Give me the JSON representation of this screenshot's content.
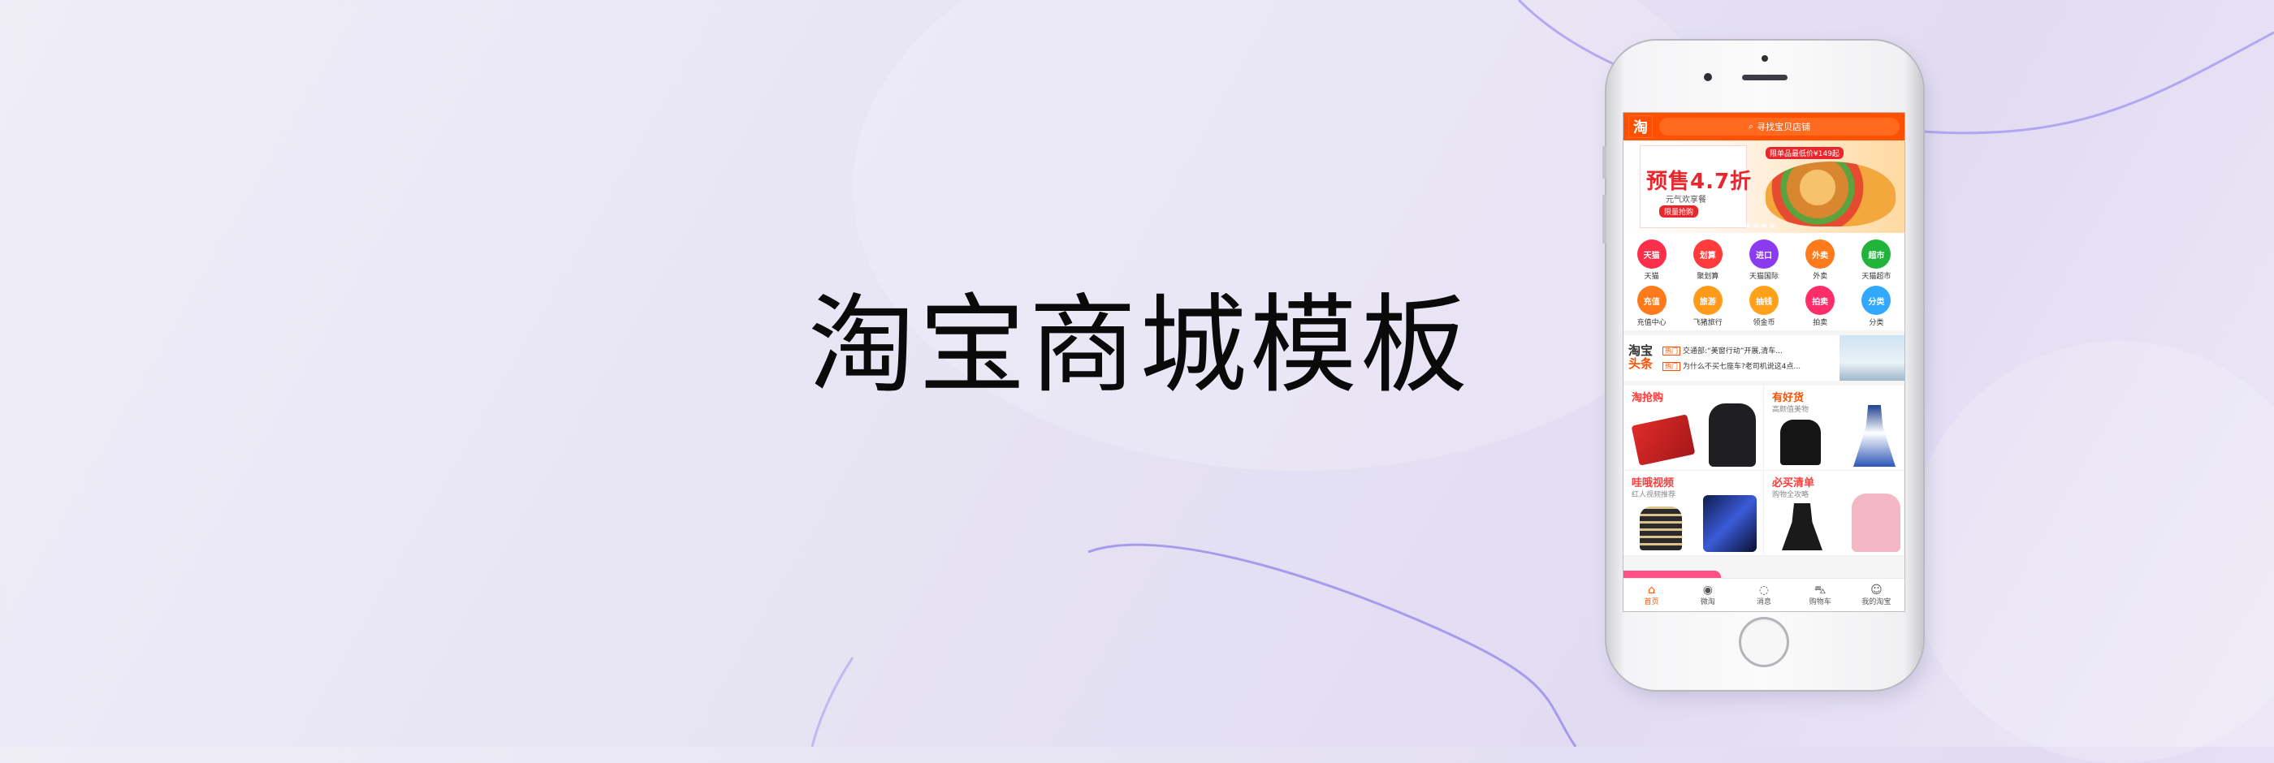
{
  "headline": "淘宝商城模板",
  "colors": {
    "brand": "#ff5000",
    "background": "#e6e3f3"
  },
  "app": {
    "logo": "淘",
    "search_placeholder": "寻找宝贝店铺",
    "banner": {
      "top_tag": "限单品最低价¥149起",
      "main_text": "预售4.7折",
      "sub_text": "元气欢享餐",
      "button": "限量抢购"
    },
    "icons_row1": [
      {
        "badge": "天猫",
        "label": "天猫",
        "color": "#ff2e4a"
      },
      {
        "badge": "划算",
        "label": "聚划算",
        "color": "#ff3b3b"
      },
      {
        "badge": "进口",
        "label": "天猫国际",
        "color": "#8a3bf0"
      },
      {
        "badge": "外卖",
        "label": "外卖",
        "color": "#ff7a1a"
      },
      {
        "badge": "超市",
        "label": "天猫超市",
        "color": "#22b33a"
      }
    ],
    "icons_row2": [
      {
        "badge": "充值",
        "label": "充值中心",
        "color": "#ff7a1a"
      },
      {
        "badge": "旅游",
        "label": "飞猪旅行",
        "color": "#ff9a1a"
      },
      {
        "badge": "抽钱",
        "label": "领金币",
        "color": "#ffa21a"
      },
      {
        "badge": "拍卖",
        "label": "拍卖",
        "color": "#ff2e6a"
      },
      {
        "badge": "分类",
        "label": "分类",
        "color": "#33a8ff"
      }
    ],
    "headlines": {
      "logo_line1": "淘宝",
      "logo_line2": "头条",
      "tag": "热门",
      "line1": "交通部:“美窗行动”开展,清车...",
      "line2": "为什么不买七座车?老司机说这4点..."
    },
    "sections": [
      {
        "title": "淘抢购",
        "subtitle": "",
        "color": "#ff3b3b"
      },
      {
        "title": "有好货",
        "subtitle": "高颜值美物",
        "color": "#ff5000"
      },
      {
        "title": "哇哦视频",
        "subtitle": "红人视频推荐",
        "color": "#ff3b3b"
      },
      {
        "title": "必买清单",
        "subtitle": "购物全攻略",
        "color": "#ff3b3b"
      }
    ],
    "bottom_nav": [
      {
        "icon": "home-icon",
        "label": "首页",
        "glyph": "⌂"
      },
      {
        "icon": "weitao-icon",
        "label": "微淘",
        "glyph": "◉"
      },
      {
        "icon": "message-icon",
        "label": "消息",
        "glyph": "◌"
      },
      {
        "icon": "cart-icon",
        "label": "购物车",
        "glyph": "🛒"
      },
      {
        "icon": "profile-icon",
        "label": "我的淘宝",
        "glyph": "☺"
      }
    ]
  }
}
